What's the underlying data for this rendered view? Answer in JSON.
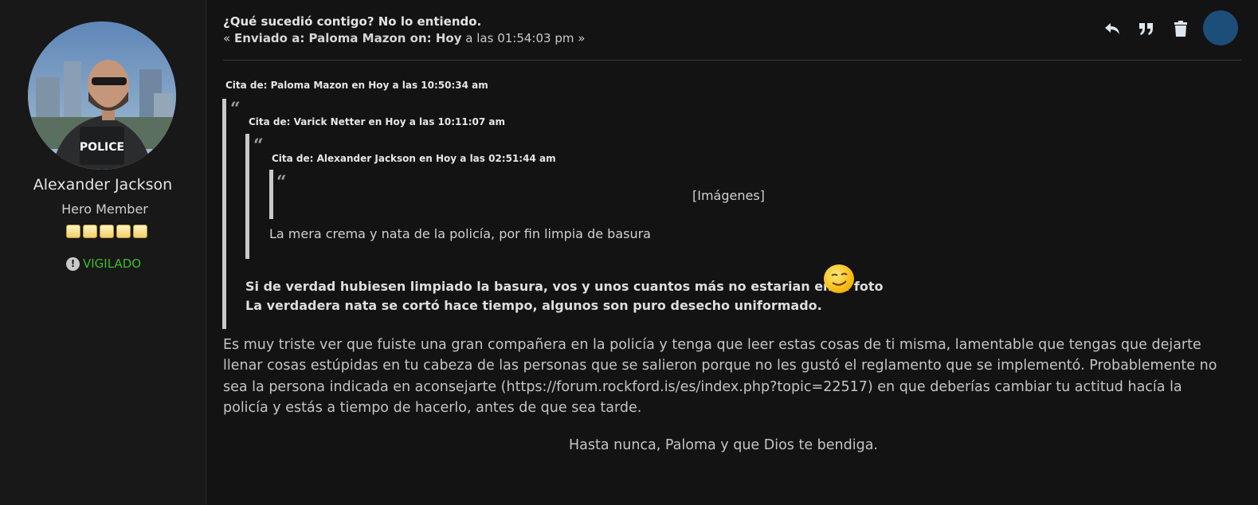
{
  "user": {
    "name": "Alexander Jackson",
    "rank": "Hero Member",
    "stars": 5,
    "status_label": "VIGILADO",
    "avatar_badge": "POLICE",
    "colors": {
      "status": "#3fba2a",
      "accent": "#1d4e79"
    }
  },
  "post": {
    "title": "¿Qué sucedió contigo? No lo entiendo.",
    "meta_prefix": "«",
    "meta_sent": "Enviado a: Paloma Mazon on: Hoy",
    "meta_time": "a las 01:54:03 pm",
    "meta_suffix": "»",
    "actions": [
      "reply-icon",
      "quote-icon",
      "trash-icon"
    ]
  },
  "quotes": {
    "q1_cite": "Cita de: Paloma Mazon en Hoy a las 10:50:34 am",
    "q2_cite": "Cita de: Varick Netter en Hoy a las 10:11:07 am",
    "q3_cite": "Cita de: Alexander Jackson en Hoy a las 02:51:44 am",
    "q3_images": "[Imágenes]",
    "q2_text": "La mera crema y nata de la policía, por fin limpia de basura",
    "q1_line1": "Si de verdad hubiesen limpiado la basura, vos y unos cuantos más no estarian en la foto",
    "q1_line2": "La verdadera nata se cortó hace tiempo, algunos son puro desecho uniformado."
  },
  "body": {
    "paragraph": "Es muy triste ver que fuiste una gran compañera en la policía y tenga que leer estas cosas de ti misma, lamentable que tengas que dejarte llenar cosas estúpidas en tu cabeza de las personas que se salieron porque no les gustó el reglamento que se implementó. Probablemente no sea la persona indicada en aconsejarte (https://forum.rockford.is/es/index.php?topic=22517) en que deberías cambiar tu actitud hacía la policía y estás a tiempo de hacerlo, antes de que sea tarde.",
    "signoff": "Hasta nunca, Paloma y que Dios te bendiga."
  }
}
